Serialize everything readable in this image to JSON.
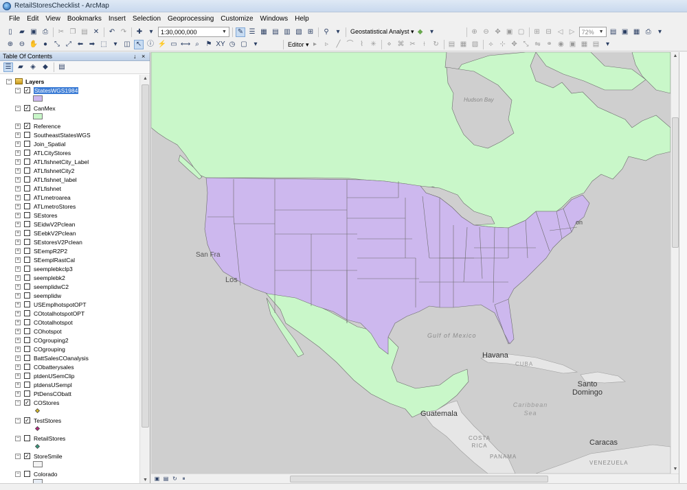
{
  "window": {
    "title": "RetailStoresChecklist - ArcMap"
  },
  "menu": [
    "File",
    "Edit",
    "View",
    "Bookmarks",
    "Insert",
    "Selection",
    "Geoprocessing",
    "Customize",
    "Windows",
    "Help"
  ],
  "toolbar": {
    "scale_value": "1:30,000,000",
    "geostat_label": "Geostatistical Analyst ▾",
    "editor_label": "Editor ▾",
    "zoom_value": "72%"
  },
  "toc": {
    "title": "Table Of Contents",
    "pin": "↓",
    "close": "×",
    "root_label": "Layers",
    "layers": [
      {
        "name": "StatesWGS1984",
        "checked": true,
        "expanded": true,
        "selected": true,
        "symbol": "fill",
        "color": "#cdb8ee"
      },
      {
        "name": "CanMex",
        "checked": true,
        "expanded": true,
        "symbol": "fill",
        "color": "#c9f7c9"
      },
      {
        "name": "Reference",
        "checked": true,
        "expanded": false
      },
      {
        "name": "SoutheastStatesWGS",
        "checked": false,
        "expanded": false
      },
      {
        "name": "Join_Spatial",
        "checked": false,
        "expanded": false
      },
      {
        "name": "ATLCityStores",
        "checked": false,
        "expanded": false
      },
      {
        "name": "ATLfishnetCity_Label",
        "checked": false,
        "expanded": false
      },
      {
        "name": "ATLfishnetCity2",
        "checked": false,
        "expanded": false
      },
      {
        "name": "ATLfishnet_label",
        "checked": false,
        "expanded": false
      },
      {
        "name": "ATLfishnet",
        "checked": false,
        "expanded": false
      },
      {
        "name": "ATLmetroarea",
        "checked": false,
        "expanded": false
      },
      {
        "name": "ATLmetroStores",
        "checked": false,
        "expanded": false
      },
      {
        "name": "SEstores",
        "checked": false,
        "expanded": false
      },
      {
        "name": "SEidwV2Pclean",
        "checked": false,
        "expanded": false
      },
      {
        "name": "SEebkV2Pclean",
        "checked": false,
        "expanded": false
      },
      {
        "name": "SEstoresV2Pclean",
        "checked": false,
        "expanded": false
      },
      {
        "name": "SEempR2P2",
        "checked": false,
        "expanded": false
      },
      {
        "name": "SEemplRastCal",
        "checked": false,
        "expanded": false
      },
      {
        "name": "seemplebkclp3",
        "checked": false,
        "expanded": false
      },
      {
        "name": "seemplebk2",
        "checked": false,
        "expanded": false
      },
      {
        "name": "seemplidwC2",
        "checked": false,
        "expanded": false
      },
      {
        "name": "seemplidw",
        "checked": false,
        "expanded": false
      },
      {
        "name": "USEmplhotspotOPT",
        "checked": false,
        "expanded": false
      },
      {
        "name": "COtotalhotspotOPT",
        "checked": false,
        "expanded": false
      },
      {
        "name": "COtotalhotspot",
        "checked": false,
        "expanded": false
      },
      {
        "name": "COhotspot",
        "checked": false,
        "expanded": false
      },
      {
        "name": "COgrouping2",
        "checked": false,
        "expanded": false
      },
      {
        "name": "COgrouping",
        "checked": false,
        "expanded": false
      },
      {
        "name": "BattSalesCOanalysis",
        "checked": false,
        "expanded": false
      },
      {
        "name": "CObatterysales",
        "checked": false,
        "expanded": false
      },
      {
        "name": "ptdenUSemClip",
        "checked": false,
        "expanded": false
      },
      {
        "name": "ptdensUSempl",
        "checked": false,
        "expanded": false
      },
      {
        "name": "PtDensCObatt",
        "checked": false,
        "expanded": false
      },
      {
        "name": "COStores",
        "checked": true,
        "expanded": true,
        "symbol": "point",
        "color": "#e0c020"
      },
      {
        "name": "TestStores",
        "checked": true,
        "expanded": true,
        "symbol": "point",
        "color": "#c02080"
      },
      {
        "name": "RetailStores",
        "checked": false,
        "expanded": true,
        "symbol": "point",
        "color": "#30a080"
      },
      {
        "name": "StoreSmile",
        "checked": true,
        "expanded": true,
        "symbol": "fill",
        "color": "#f4f4f4"
      },
      {
        "name": "Colorado",
        "checked": false,
        "expanded": true,
        "symbol": "fill",
        "color": "#e8eef6"
      }
    ]
  },
  "map": {
    "colors": {
      "ocean": "#cfcfcf",
      "canmex": "#c9f7c9",
      "states": "#cdb8ee",
      "caribbean": "#e6e6e6",
      "border": "#6b6b6b"
    },
    "labels": [
      {
        "text": "Hudson Bay",
        "kind": "water"
      },
      {
        "text": "San Fra",
        "kind": "city"
      },
      {
        "text": "Los",
        "kind": "city"
      },
      {
        "text": "Gulf of Mexico",
        "kind": "water"
      },
      {
        "text": "Havana",
        "kind": "city"
      },
      {
        "text": "CUBA",
        "kind": "country"
      },
      {
        "text": "Santo Domingo",
        "kind": "city"
      },
      {
        "text": "Caribbean Sea",
        "kind": "water"
      },
      {
        "text": "Guatemala",
        "kind": "city"
      },
      {
        "text": "COSTA RICA",
        "kind": "country"
      },
      {
        "text": "PANAMA",
        "kind": "country"
      },
      {
        "text": "Caracas",
        "kind": "city"
      },
      {
        "text": "VENEZUELA",
        "kind": "country"
      },
      {
        "text": "on",
        "kind": "city"
      }
    ]
  }
}
